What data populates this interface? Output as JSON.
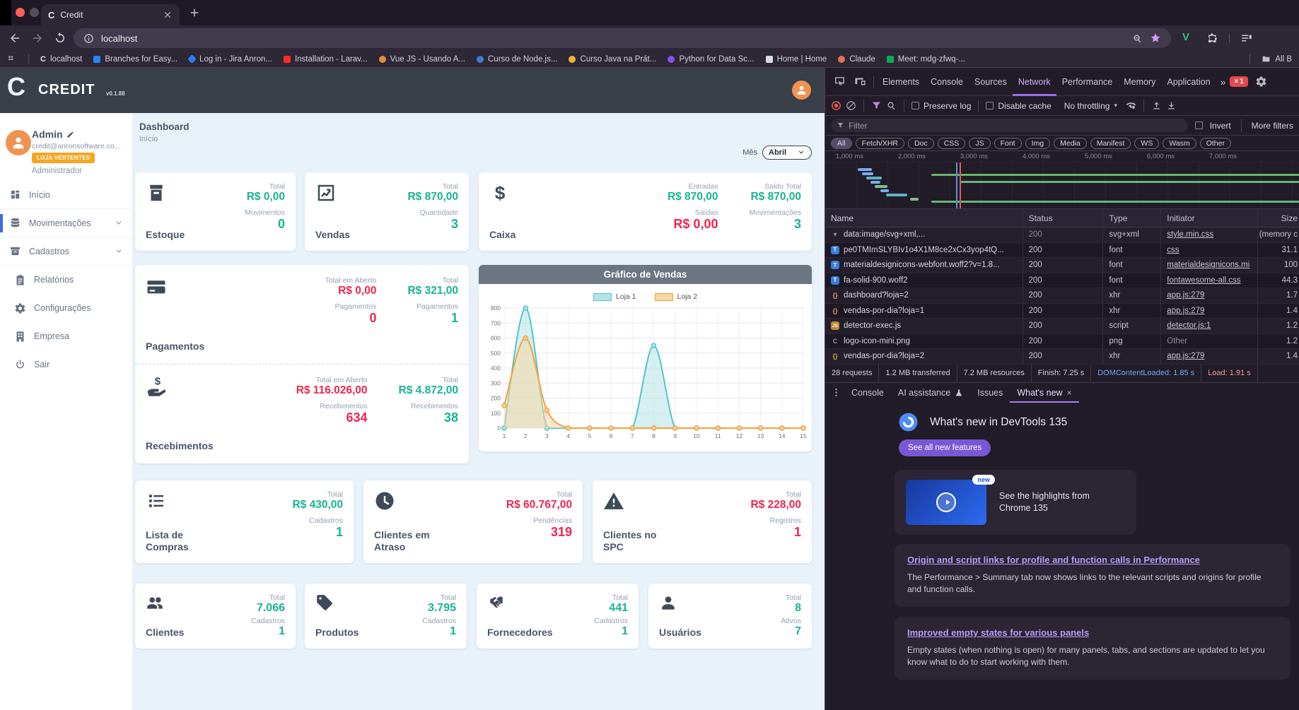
{
  "browser": {
    "tab": {
      "favicon": "C",
      "title": "Credit"
    },
    "url": "localhost",
    "bookmarks": [
      {
        "label": "localhost",
        "shape": "letter",
        "glyph": "C",
        "color": ""
      },
      {
        "label": "Branches for Easy...",
        "shape": "square",
        "color": "#2684ff"
      },
      {
        "label": "Log in - Jira Anron...",
        "shape": "diamond",
        "color": "#2f7cf6"
      },
      {
        "label": "Installation - Larav...",
        "shape": "square",
        "color": "#ff2d20"
      },
      {
        "label": "Vue JS - Usando A...",
        "shape": "circle",
        "color": "#e58e3a"
      },
      {
        "label": "Curso de Node.js...",
        "shape": "circle",
        "color": "#3f7ad6"
      },
      {
        "label": "Curso Java na Prát...",
        "shape": "circle",
        "color": "#f2b233"
      },
      {
        "label": "Python for Data Sc...",
        "shape": "circle",
        "color": "#8a4ff0"
      },
      {
        "label": "Home | Home",
        "shape": "square",
        "color": "#d8dce2"
      },
      {
        "label": "Claude",
        "shape": "circle",
        "color": "#d97757"
      },
      {
        "label": "Meet: mdg-zfwq-...",
        "shape": "square",
        "color": "#0faa53"
      }
    ],
    "all_bookmarks": "All B"
  },
  "app": {
    "brand": {
      "logo": "C",
      "name": "CREDIT",
      "version": "v0.1.88"
    },
    "user": {
      "name": "Admin",
      "email": "credit@anronsoftware.co...",
      "store_badge": "LOJA VERTENTES",
      "role": "Administrador"
    },
    "menu": [
      {
        "icon": "grid",
        "label": "Início",
        "rowcls": "sep"
      },
      {
        "icon": "db",
        "label": "Movimentações",
        "chev": "show",
        "ind": "on",
        "rowcls": "sep"
      },
      {
        "icon": "archive",
        "label": "Cadastros",
        "chev": "show",
        "rowcls": "sep"
      },
      {
        "icon": "clipboard",
        "label": "Relatórios",
        "rowcls": "ind2"
      },
      {
        "icon": "gear",
        "label": "Configurações",
        "rowcls": "ind2"
      },
      {
        "icon": "building",
        "label": "Empresa",
        "rowcls": "ind2"
      },
      {
        "icon": "power",
        "label": "Sair",
        "rowcls": "ind2"
      }
    ],
    "page": {
      "title": "Dashboard",
      "subtitle": "Início"
    },
    "month_filter": {
      "label": "Mês",
      "value": "Abril"
    },
    "cards": {
      "estoque": {
        "title": "Estoque",
        "stats": [
          {
            "label": "Total",
            "value": "R$ 0,00",
            "cls": "green"
          },
          {
            "label": "Movimentos",
            "value": "0",
            "cls": "green"
          }
        ]
      },
      "vendas": {
        "title": "Vendas",
        "stats": [
          {
            "label": "Total",
            "value": "R$ 870,00",
            "cls": "green"
          },
          {
            "label": "Quantidade",
            "value": "3",
            "cls": "green"
          }
        ]
      },
      "caixa": {
        "title": "Caixa",
        "stats_left": [
          {
            "label": "Entradas",
            "value": "R$ 870,00",
            "cls": "green"
          },
          {
            "label": "Saídas",
            "value": "R$ 0,00",
            "cls": "red"
          }
        ],
        "stats_right": [
          {
            "label": "Saldo Total",
            "value": "R$ 870,00",
            "cls": "green"
          },
          {
            "label": "Movimentações",
            "value": "3",
            "cls": "green"
          }
        ]
      },
      "pagamentos": {
        "title": "Pagamentos",
        "stats_left": [
          {
            "label": "Total em Aberto",
            "value": "R$ 0,00",
            "cls": "red"
          },
          {
            "label": "Pagamentos",
            "value": "0",
            "cls": "red"
          }
        ],
        "stats_right": [
          {
            "label": "Total",
            "value": "R$ 321,00",
            "cls": "green"
          },
          {
            "label": "Pagamentos",
            "value": "1",
            "cls": "green"
          }
        ]
      },
      "recebimentos": {
        "title": "Recebimentos",
        "stats_left": [
          {
            "label": "Total em Aberto",
            "value": "R$ 116.026,00",
            "cls": "red"
          },
          {
            "label": "Recebimentos",
            "value": "634",
            "cls": "red"
          }
        ],
        "stats_right": [
          {
            "label": "Total",
            "value": "R$ 4.872,00",
            "cls": "green"
          },
          {
            "label": "Recebimentos",
            "value": "38",
            "cls": "green"
          }
        ]
      },
      "lista_compras": {
        "title": "Lista de Compras",
        "stats": [
          {
            "label": "Total",
            "value": "R$ 430,00",
            "cls": "green"
          },
          {
            "label": "Cadastros",
            "value": "1",
            "cls": "green"
          }
        ]
      },
      "clientes_atraso": {
        "title": "Clientes em Atraso",
        "stats": [
          {
            "label": "Total",
            "value": "R$ 60.767,00",
            "cls": "red"
          },
          {
            "label": "Pendências",
            "value": "319",
            "cls": "red"
          }
        ]
      },
      "clientes_spc": {
        "title": "Clientes no SPC",
        "stats": [
          {
            "label": "Total",
            "value": "R$ 228,00",
            "cls": "red"
          },
          {
            "label": "Registros",
            "value": "1",
            "cls": "red"
          }
        ]
      },
      "clientes": {
        "title": "Clientes",
        "stats": [
          {
            "label": "Total",
            "value": "7.066",
            "cls": "green"
          },
          {
            "label": "Cadastros",
            "value": "1",
            "cls": "green"
          }
        ]
      },
      "produtos": {
        "title": "Produtos",
        "stats": [
          {
            "label": "Total",
            "value": "3.795",
            "cls": "green"
          },
          {
            "label": "Cadastros",
            "value": "1",
            "cls": "green"
          }
        ]
      },
      "fornecedores": {
        "title": "Fornecedores",
        "stats": [
          {
            "label": "Total",
            "value": "441",
            "cls": "green"
          },
          {
            "label": "Cadastros",
            "value": "1",
            "cls": "green"
          }
        ]
      },
      "usuarios": {
        "title": "Usuários",
        "stats": [
          {
            "label": "Total",
            "value": "8",
            "cls": "green"
          },
          {
            "label": "Ativos",
            "value": "7",
            "cls": "green"
          }
        ]
      }
    }
  },
  "chart_data": {
    "type": "line",
    "title": "Gráfico de Vendas",
    "x": [
      1,
      2,
      3,
      4,
      5,
      6,
      7,
      8,
      9,
      10,
      11,
      12,
      13,
      14,
      15
    ],
    "series": [
      {
        "name": "Loja 1",
        "color": "#52c5ca",
        "fill": "#b5e4e6",
        "values": [
          0,
          800,
          0,
          0,
          0,
          0,
          0,
          550,
          0,
          0,
          0,
          0,
          0,
          0,
          0
        ]
      },
      {
        "name": "Loja 2",
        "color": "#f2a13c",
        "fill": "#f8d7a4",
        "values": [
          150,
          600,
          120,
          0,
          0,
          0,
          0,
          0,
          0,
          0,
          0,
          0,
          0,
          0,
          0
        ]
      }
    ],
    "ylim": [
      0,
      800
    ],
    "ytick_step": 100,
    "grid": true,
    "legend_position": "top",
    "smooth": true
  },
  "devtools": {
    "tabs": [
      {
        "label": "Elements"
      },
      {
        "label": "Console"
      },
      {
        "label": "Sources"
      },
      {
        "label": "Network",
        "active": "active"
      },
      {
        "label": "Performance"
      },
      {
        "label": "Memory"
      },
      {
        "label": "Application"
      }
    ],
    "more_tabs": "»",
    "error_badge": "1",
    "toolbar": {
      "preserve_log": "Preserve log",
      "disable_cache": "Disable cache",
      "throttling": "No throttling"
    },
    "filter": {
      "placeholder": "Filter",
      "invert": "Invert",
      "more": "More filters"
    },
    "chips": [
      {
        "label": "All",
        "active": "active"
      },
      {
        "label": "Fetch/XHR"
      },
      {
        "label": "Doc"
      },
      {
        "label": "CSS"
      },
      {
        "label": "JS"
      },
      {
        "label": "Font"
      },
      {
        "label": "Img"
      },
      {
        "label": "Media"
      },
      {
        "label": "Manifest"
      },
      {
        "label": "WS"
      },
      {
        "label": "Wasm"
      },
      {
        "label": "Other"
      }
    ],
    "ruler": [
      {
        "label": "1,000 ms"
      },
      {
        "label": "2,000 ms"
      },
      {
        "label": "3,000 ms"
      },
      {
        "label": "4,000 ms"
      },
      {
        "label": "5,000 ms"
      },
      {
        "label": "6,000 ms"
      },
      {
        "label": "7,000 ms"
      }
    ],
    "table": {
      "columns": [
        {
          "label": "Name",
          "cls": "c0"
        },
        {
          "label": "Status",
          "cls": "c1"
        },
        {
          "label": "Type",
          "cls": "c2"
        },
        {
          "label": "Initiator",
          "cls": "c3"
        },
        {
          "label": "Size",
          "cls": "c4"
        }
      ],
      "rows": [
        {
          "icon": "▾",
          "iconCls": "caret",
          "name": "data:image/svg+xml,...",
          "status": "200",
          "statusCls": "dim",
          "type": "svg+xml",
          "initiator": "style.min.css",
          "initCls": "lnk",
          "size": "(memory c",
          "rowCls": "odd"
        },
        {
          "icon": "T",
          "iconCls": "font",
          "name": "pe0TMImSLYBIv1o4X1M8ce2xCx3yop4tQ...",
          "status": "200",
          "type": "font",
          "initiator": "css",
          "initCls": "lnk",
          "size": "31.1",
          "rowCls": "even"
        },
        {
          "icon": "T",
          "iconCls": "font",
          "name": "materialdesignicons-webfont.woff2?v=1.8...",
          "status": "200",
          "type": "font",
          "initiator": "materialdesignicons.mi",
          "initCls": "lnk",
          "size": "100",
          "rowCls": "odd"
        },
        {
          "icon": "T",
          "iconCls": "font",
          "name": "fa-solid-900.woff2",
          "status": "200",
          "type": "font",
          "initiator": "fontawesome-all.css",
          "initCls": "lnk",
          "size": "44.3",
          "rowCls": "even"
        },
        {
          "icon": "{}",
          "iconCls": "xhr",
          "name": "dashboard?loja=2",
          "status": "200",
          "type": "xhr",
          "initiator": "app.js:279",
          "initCls": "lnk",
          "size": "1.7",
          "rowCls": "odd"
        },
        {
          "icon": "{}",
          "iconCls": "xhr",
          "name": "vendas-por-dia?loja=1",
          "status": "200",
          "type": "xhr",
          "initiator": "app.js:279",
          "initCls": "lnk",
          "size": "1.4",
          "rowCls": "even"
        },
        {
          "icon": "JS",
          "iconCls": "script",
          "name": "detector-exec.js",
          "status": "200",
          "type": "script",
          "initiator": "detector.js:1",
          "initCls": "lnk",
          "size": "1.2",
          "rowCls": "odd"
        },
        {
          "icon": "C",
          "iconCls": "png",
          "name": "logo-icon-mini.png",
          "status": "200",
          "type": "png",
          "initiator": "Other",
          "initCls": "dim",
          "size": "1.2",
          "rowCls": "even"
        },
        {
          "icon": "{}",
          "iconCls": "xhr",
          "name": "vendas-por-dia?loja=2",
          "status": "200",
          "type": "xhr",
          "initiator": "app.js:279",
          "initCls": "lnk",
          "size": "1.4",
          "rowCls": "odd"
        }
      ]
    },
    "summary": [
      {
        "text": "28 requests"
      },
      {
        "text": "1.2 MB transferred"
      },
      {
        "text": "7.2 MB resources"
      },
      {
        "text": "Finish: 7.25 s"
      },
      {
        "text": "DOMContentLoaded: 1.85 s",
        "cls": "blue"
      },
      {
        "text": "Load: 1.91 s",
        "cls": "red2"
      }
    ],
    "drawer": {
      "console": "Console",
      "ai": "AI assistance",
      "issues": "Issues",
      "whatsnew_tab": "What's new",
      "whatsnew": {
        "title": "What's new in DevTools 135",
        "button": "See all new features",
        "badge": "new",
        "highlight": "See the highlights from Chrome 135",
        "sections": [
          {
            "title": "Origin and script links for profile and function calls in Performance",
            "body": "The Performance > Summary tab now shows links to the relevant scripts and origins for profile and function calls."
          },
          {
            "title": "Improved empty states for various panels",
            "body": "Empty states (when nothing is open) for many panels, tabs, and sections are updated to let you know what to do to start working with them."
          }
        ]
      }
    }
  }
}
